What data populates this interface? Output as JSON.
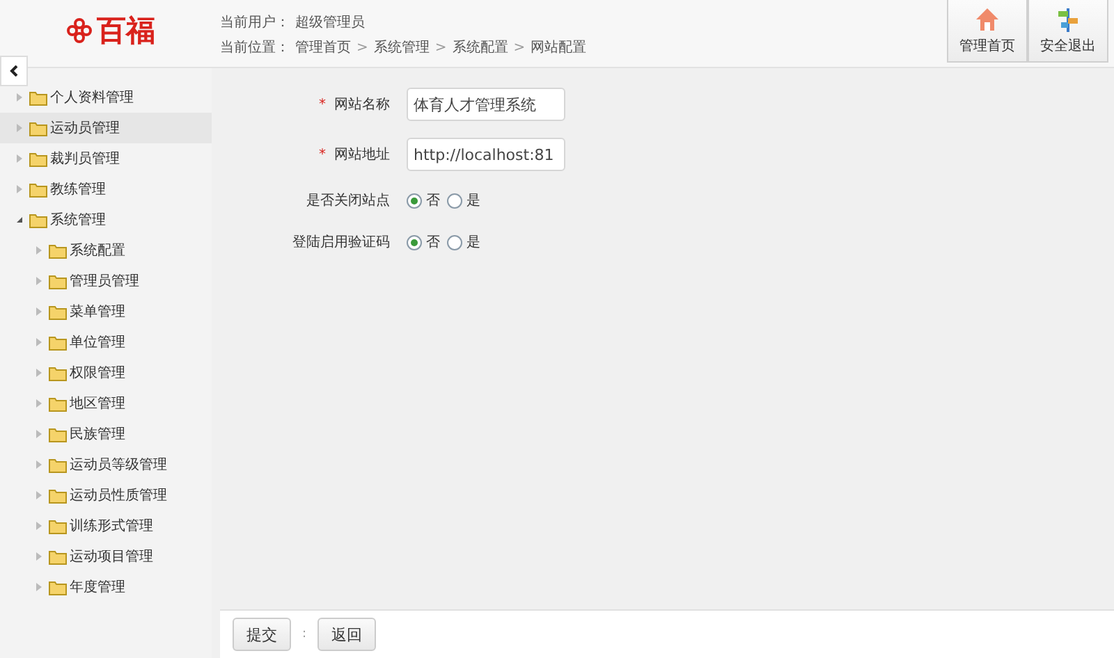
{
  "header": {
    "logo": "百福",
    "current_user": {
      "label": "当前用户：",
      "value": "超级管理员"
    },
    "breadcrumb": {
      "label": "当前位置：",
      "items": [
        "管理首页",
        "系统管理",
        "系统配置",
        "网站配置"
      ],
      "separator": ">"
    },
    "actions": [
      {
        "kind": "home",
        "label": "管理首页"
      },
      {
        "kind": "logout",
        "label": "安全退出"
      }
    ]
  },
  "sidebar": {
    "items": [
      {
        "label": "个人资料管理",
        "selected": false,
        "expanded": false
      },
      {
        "label": "运动员管理",
        "selected": true,
        "expanded": false
      },
      {
        "label": "裁判员管理",
        "selected": false,
        "expanded": false
      },
      {
        "label": "教练管理",
        "selected": false,
        "expanded": false
      },
      {
        "label": "系统管理",
        "selected": false,
        "expanded": true,
        "children": [
          {
            "label": "系统配置",
            "selected": false
          },
          {
            "label": "管理员管理",
            "selected": false
          },
          {
            "label": "菜单管理",
            "selected": false
          },
          {
            "label": "单位管理",
            "selected": false
          },
          {
            "label": "权限管理",
            "selected": false
          },
          {
            "label": "地区管理",
            "selected": false
          },
          {
            "label": "民族管理",
            "selected": false
          },
          {
            "label": "运动员等级管理",
            "selected": false
          },
          {
            "label": "运动员性质管理",
            "selected": false
          },
          {
            "label": "训练形式管理",
            "selected": false
          },
          {
            "label": "运动项目管理",
            "selected": false
          },
          {
            "label": "年度管理",
            "selected": false
          }
        ]
      }
    ]
  },
  "form": {
    "fields": [
      {
        "kind": "text",
        "label": "网站名称",
        "required_mark": "*",
        "value": "体育人才管理系统"
      },
      {
        "kind": "text",
        "label": "网站地址",
        "required_mark": "*",
        "value": "http://localhost:81"
      },
      {
        "kind": "radio",
        "label": "是否关闭站点",
        "options": [
          {
            "label": "否",
            "selected": true
          },
          {
            "label": "是",
            "selected": false
          }
        ]
      },
      {
        "kind": "radio",
        "label": "登陆启用验证码",
        "options": [
          {
            "label": "否",
            "selected": true
          },
          {
            "label": "是",
            "selected": false
          }
        ]
      }
    ]
  },
  "footer": {
    "buttons": [
      "提交",
      "返回"
    ],
    "separator": ":"
  }
}
